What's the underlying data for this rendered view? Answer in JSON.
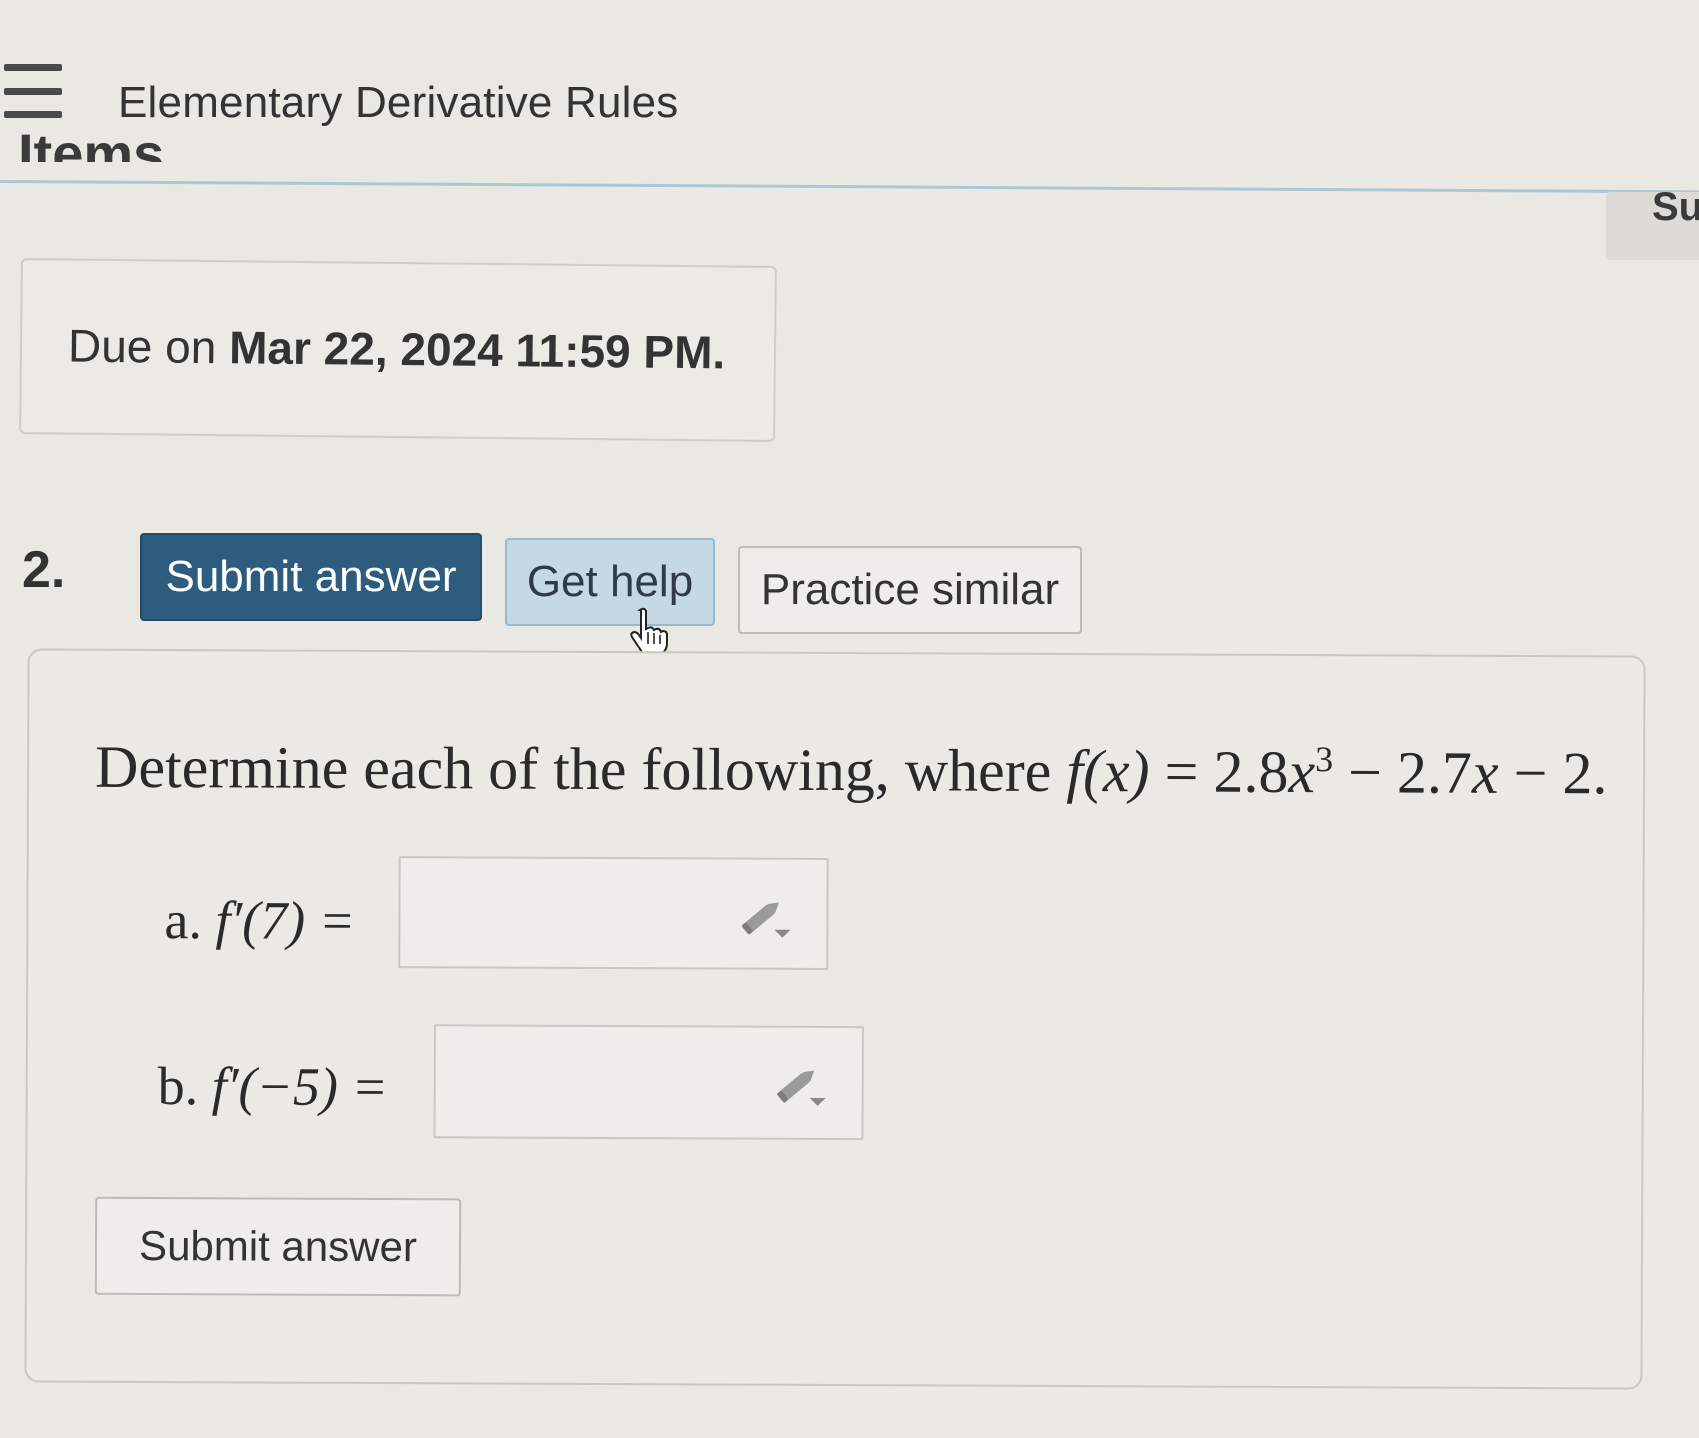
{
  "header": {
    "menu_icon": "hamburger-menu-icon",
    "title": "Elementary Derivative Rules",
    "section_heading": "Items",
    "side_tab_label": "Su"
  },
  "due": {
    "prefix": "Due on",
    "date": "Mar 22, 2024 11:59 PM."
  },
  "question": {
    "number": "2.",
    "buttons": {
      "submit": "Submit answer",
      "help": "Get help",
      "practice": "Practice similar"
    },
    "prompt_text": "Determine each of the following, where ",
    "function_lhs": "f(x)",
    "function_rhs_a": " = 2.8",
    "function_var": "x",
    "function_exp": "3",
    "function_rhs_b": " − 2.7",
    "function_var2": "x",
    "function_rhs_c": " − 2.",
    "parts": [
      {
        "label": "a.",
        "expr": "f′(7) =",
        "value": ""
      },
      {
        "label": "b.",
        "expr": "f′(−5) =",
        "value": ""
      }
    ],
    "bottom_submit": "Submit answer"
  },
  "colors": {
    "primary": "#2d5c7e",
    "help_bg": "#c5d8e6",
    "rule": "#a9c7d6"
  }
}
